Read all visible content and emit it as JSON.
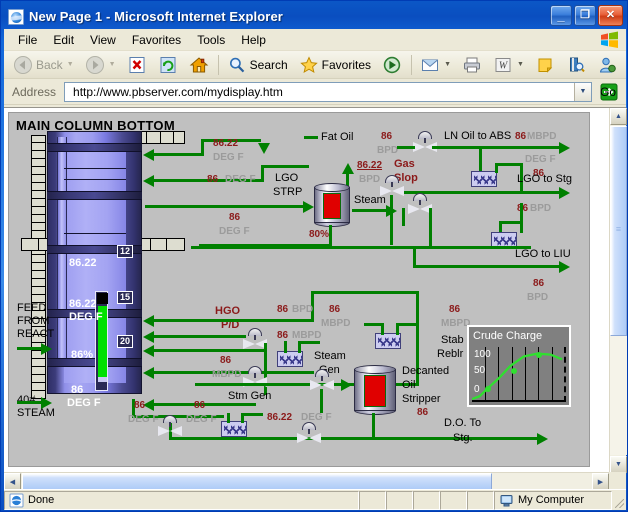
{
  "window": {
    "title": "New Page 1 - Microsoft Internet Explorer",
    "icon": "ie-page-icon",
    "buttons": {
      "minimize": "_",
      "maximize": "❐",
      "close": "✕"
    }
  },
  "menu": {
    "items": [
      "File",
      "Edit",
      "View",
      "Favorites",
      "Tools",
      "Help"
    ]
  },
  "toolbar": {
    "back": "Back",
    "forward": "",
    "stop": "",
    "refresh": "",
    "home": "",
    "search": "Search",
    "favorites": "Favorites",
    "media": "",
    "mail": "",
    "print": "",
    "edit": "",
    "notes": "",
    "research": "",
    "messenger": ""
  },
  "address": {
    "label": "Address",
    "value": "http://www.pbserver.com/mydisplay.htm",
    "go": "Go"
  },
  "status": {
    "main": "Done",
    "zone": "My Computer"
  },
  "diagram": {
    "title": "MAIN COLUMN BOTTOM",
    "column": {
      "tray_tags": [
        "12",
        "15",
        "20"
      ],
      "readings": [
        {
          "value": "86.22",
          "unit": "DEG F"
        },
        {
          "value": "86.22",
          "unit": "DEG F"
        },
        {
          "value": "86%",
          "unit": ""
        },
        {
          "value": "86",
          "unit": "DEG F"
        }
      ],
      "feed_label_1": "FEED",
      "feed_label_2": "FROM",
      "feed_label_3": "REACT",
      "steam_label_1": "40#",
      "steam_label_2": "STEAM"
    },
    "equipment": {
      "lgo_strp_1": "LGO",
      "lgo_strp_2": "STRP",
      "lgo_strp_pct": "80%",
      "steam": "Steam",
      "gas_slop_1": "Gas",
      "gas_slop_2": "Slop",
      "fat_oil": "Fat Oil",
      "hgo_pid_1": "HGO",
      "hgo_pid_2": "P/D",
      "steam_gen_1": "Steam",
      "steam_gen_2": "Gen",
      "stm_gen": "Stm Gen",
      "stab_reblr_1": "Stab",
      "stab_reblr_2": "Reblr",
      "decanted_1": "Decanted",
      "decanted_2": "Oil",
      "decanted_3": "Stripper",
      "decanted_val": "86",
      "do_to_stg_1": "D.O. To",
      "do_to_stg_2": "Stg."
    },
    "streams": {
      "ln_oil_to_abs": "LN Oil to ABS",
      "lgo_to_stg": "LGO to Stg",
      "lgo_to_liu": "LGO to LIU"
    },
    "values": [
      {
        "num": "86.22",
        "unit": "DEG F"
      },
      {
        "num": "86",
        "unit": "DEG F"
      },
      {
        "num": "86",
        "unit": "DEG F"
      },
      {
        "num": "86",
        "unit": "BPD"
      },
      {
        "num": "86.22",
        "unit": "BPD"
      },
      {
        "num": "86",
        "unit": "MBPD"
      },
      {
        "num": "86",
        "unit": "DEG F"
      },
      {
        "num": "86",
        "unit": "BPD"
      },
      {
        "num": "86",
        "unit": "BPD"
      },
      {
        "num": "86",
        "unit": "BPD"
      },
      {
        "num": "86",
        "unit": "MBPD"
      },
      {
        "num": "86",
        "unit": "MBPD"
      },
      {
        "num": "86",
        "unit": "MBPD"
      },
      {
        "num": "86",
        "unit": "MBPD"
      },
      {
        "num": "86",
        "unit": "DEG F"
      },
      {
        "num": "86",
        "unit": "DEG F"
      },
      {
        "num": "86.22",
        "unit": "DEG F"
      }
    ]
  },
  "chart_data": {
    "type": "line",
    "title": "Crude Charge",
    "xlabel": "",
    "ylabel": "",
    "ylim": [
      0,
      125
    ],
    "yticks": [
      0,
      50,
      100
    ],
    "grid": true,
    "legend": "none",
    "line_color": "#2fe02f",
    "x": [
      0,
      1,
      2,
      3,
      4,
      5,
      6
    ],
    "values": [
      -8,
      0,
      28,
      55,
      85,
      103,
      98
    ],
    "markers_at": [
      1,
      3,
      5
    ]
  },
  "colors": {
    "pipe": "#008000",
    "value_red": "#8b1a1a",
    "unit_gray": "#9b9b9b",
    "diagram_bg": "#c0c0c0",
    "titlebar": "#1267da",
    "trend_line": "#2fe02f"
  }
}
